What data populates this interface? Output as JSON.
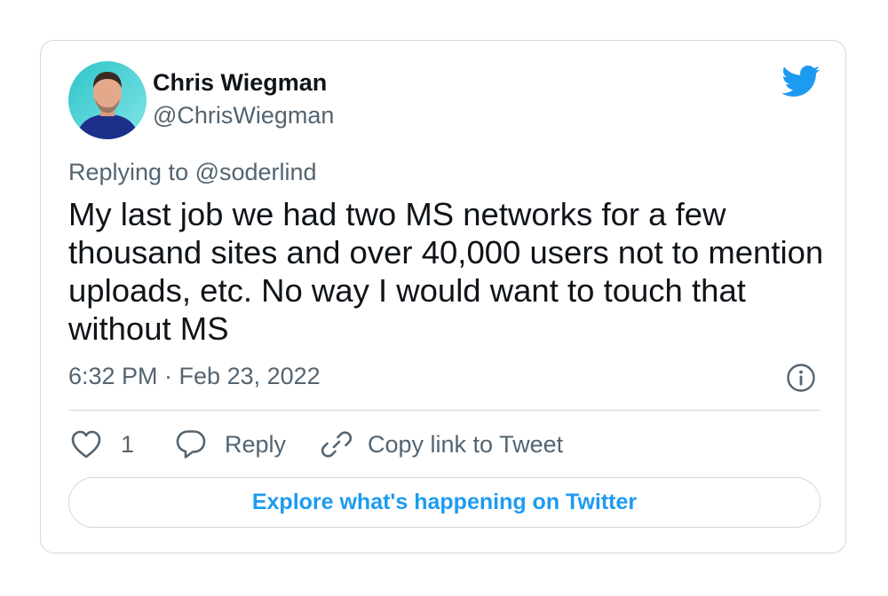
{
  "author": {
    "name": "Chris Wiegman",
    "handle": "@ChrisWiegman"
  },
  "reply_context": "Replying to @soderlind",
  "tweet_text": "My last job we had two MS networks for a few thousand sites and over 40,000 users not to mention uploads, etc. No way I would want to touch that without MS",
  "timestamp": "6:32 PM · Feb 23, 2022",
  "actions": {
    "like_count": "1",
    "reply_label": "Reply",
    "copy_label": "Copy link to Tweet"
  },
  "explore_label": "Explore what's happening on Twitter",
  "icons": [
    "twitter-bird-icon",
    "info-icon",
    "heart-icon",
    "reply-bubble-icon",
    "link-icon"
  ],
  "colors": {
    "brand": "#1d9bf0",
    "text_primary": "#0f1419",
    "text_secondary": "#536471",
    "border": "#cfd9de"
  }
}
